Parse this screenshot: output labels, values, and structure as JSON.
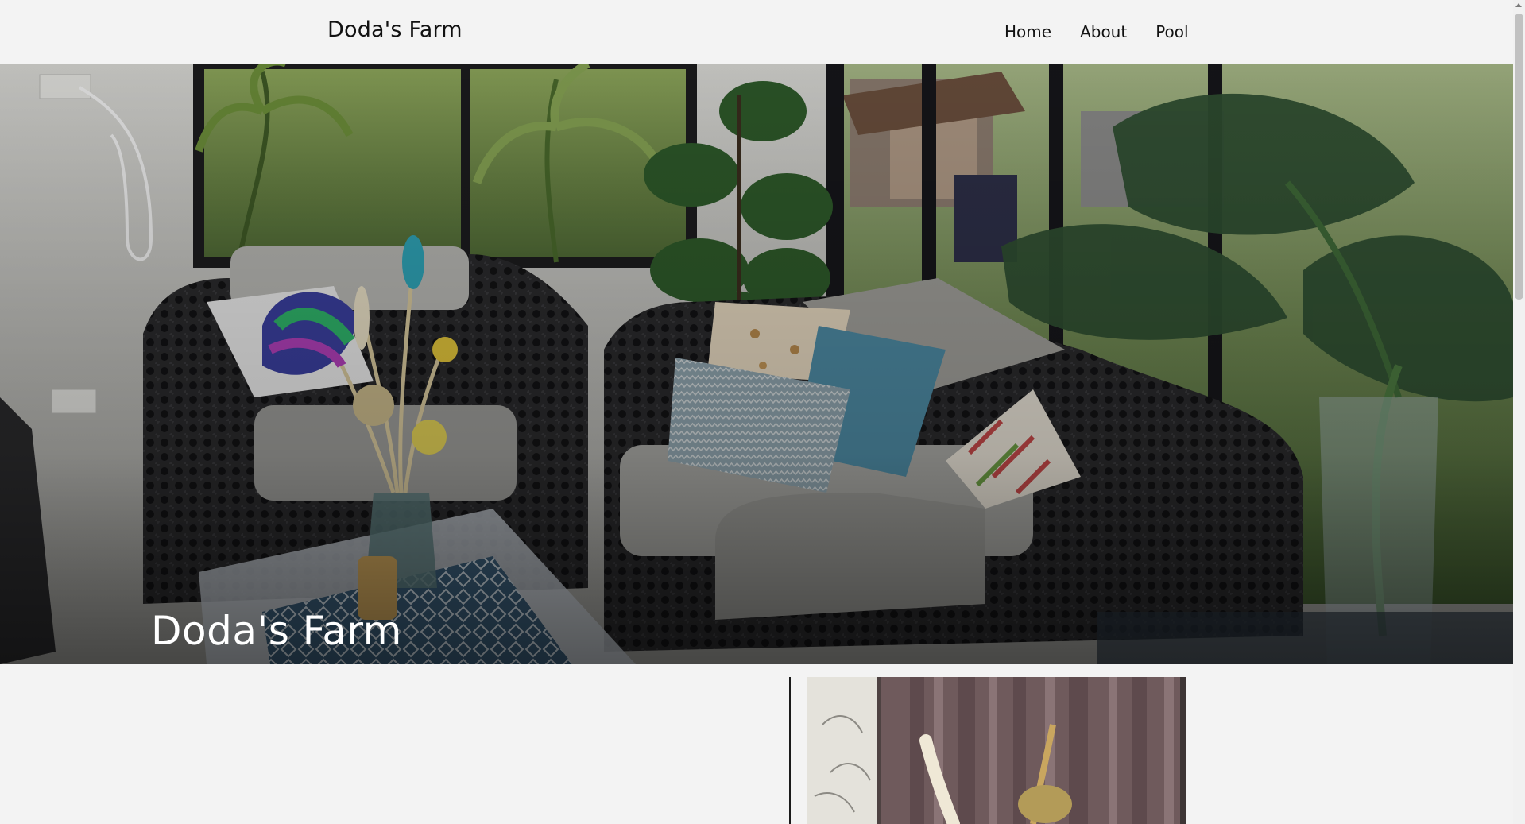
{
  "header": {
    "brand": "Doda's Farm",
    "nav": [
      {
        "label": "Home"
      },
      {
        "label": "About"
      },
      {
        "label": "Pool"
      }
    ]
  },
  "hero": {
    "title": "Doda's Farm",
    "image_icon": "living-room-photo"
  },
  "content": {
    "image_icon": "curtain-dried-flowers-photo"
  },
  "colors": {
    "background": "#f3f3f3",
    "text": "#111111",
    "hero_text": "#ffffff"
  }
}
